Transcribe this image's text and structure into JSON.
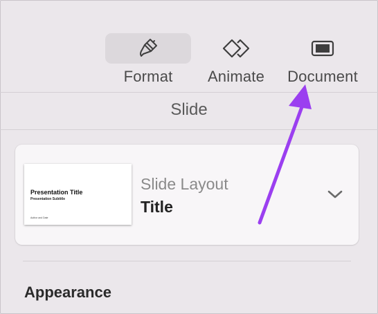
{
  "toolbar": {
    "format_label": "Format",
    "animate_label": "Animate",
    "document_label": "Document",
    "format_icon": "paintbrush-icon",
    "animate_icon": "animate-diamonds-icon",
    "document_icon": "document-icon"
  },
  "section": {
    "title": "Slide"
  },
  "slide_layout": {
    "label": "Slide Layout",
    "value": "Title",
    "thumbnail": {
      "title": "Presentation Title",
      "subtitle": "Presentation Subtitle",
      "footer": "Author and Date"
    }
  },
  "appearance": {
    "heading": "Appearance"
  },
  "annotation": {
    "arrow_color": "#9b3ff0"
  },
  "colors": {
    "panel_bg": "#ebe7eb",
    "card_bg": "#f8f6f8",
    "active_tab_bg": "#dcd8dc"
  }
}
